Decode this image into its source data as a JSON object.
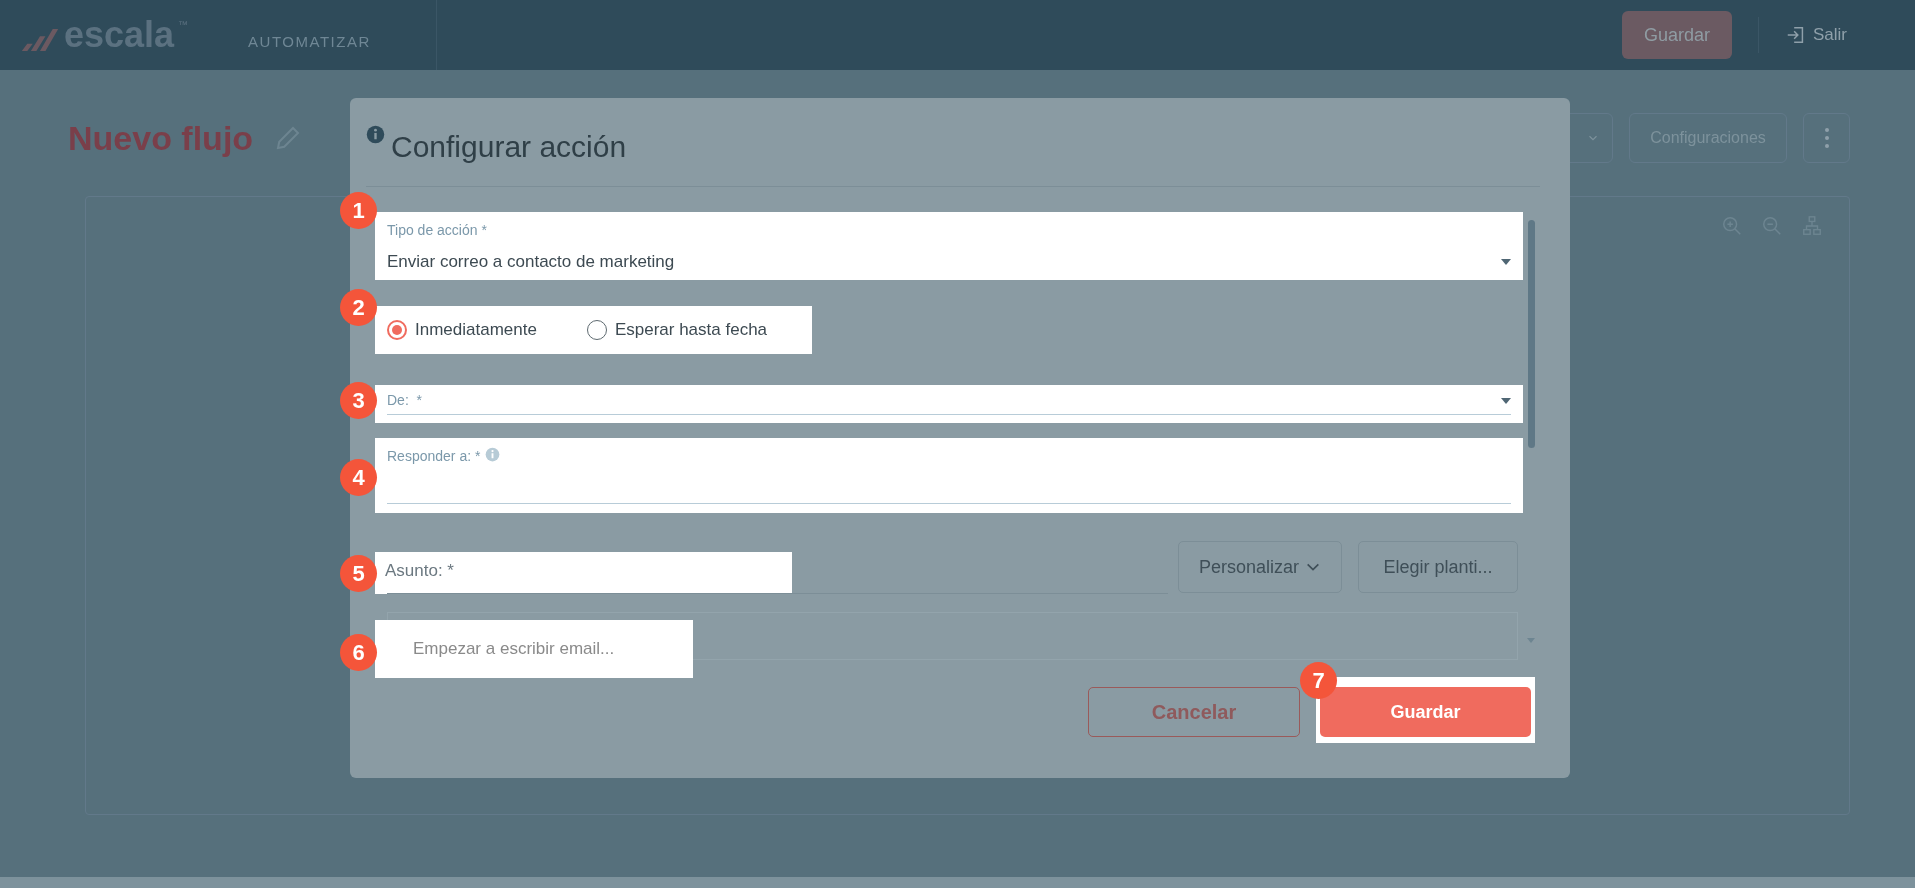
{
  "top_bar": {
    "logo_text": "escala",
    "logo_mark": "™",
    "nav_item": "AUTOMATIZAR",
    "save_button": "Guardar",
    "exit_link": "Salir"
  },
  "page": {
    "title": "Nuevo flujo",
    "settings_button": "Configuraciones"
  },
  "modal": {
    "title": "Configurar acción",
    "action_type": {
      "label": "Tipo de acción *",
      "value": "Enviar correo a contacto de marketing"
    },
    "timing_options": [
      {
        "label": "Inmediatamente",
        "selected": true
      },
      {
        "label": "Esperar hasta fecha",
        "selected": false
      }
    ],
    "from_field": {
      "label": "De:  *"
    },
    "reply_to_field": {
      "label": "Responder a: *"
    },
    "subject_field": {
      "label": "Asunto: *"
    },
    "personalize_button": "Personalizar",
    "template_button": "Elegir planti...",
    "editor": {
      "placeholder": "Empezar a escribir email..."
    },
    "cancel_button": "Cancelar",
    "save_button": "Guardar"
  },
  "callouts": [
    "1",
    "2",
    "3",
    "4",
    "5",
    "6",
    "7"
  ]
}
